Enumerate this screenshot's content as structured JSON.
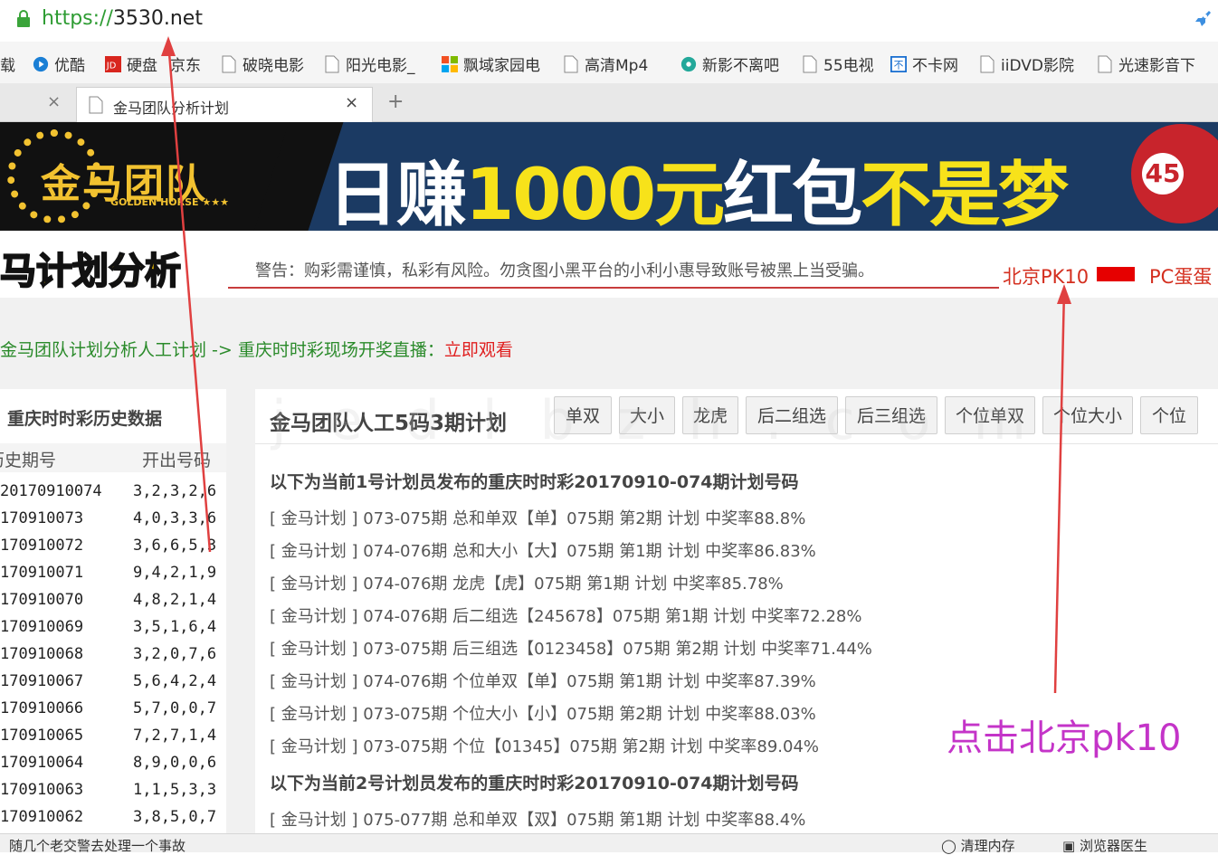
{
  "browser": {
    "url_protocol": "https://",
    "url_host": "3530.net",
    "bookmarks": [
      "载",
      "优酷",
      "硬盘",
      "京东",
      "破晓电影",
      "阳光电影_",
      "飘域家园电",
      "高清Mp4",
      "新影不离吧",
      "55电视",
      "不卡网",
      "iiDVD影院",
      "光速影音下"
    ],
    "active_tab_title": "金马团队分析计划",
    "close_glyph": "×",
    "new_tab_glyph": "+"
  },
  "banner": {
    "logo_text": "金马团队",
    "logo_sub": "GOLDEN HORSE ★★★",
    "slogan_a": "日赚",
    "slogan_b": "1000元",
    "slogan_c": "红包",
    "slogan_d": "不是梦",
    "ball_number": "45"
  },
  "header": {
    "brand": "马计划分析",
    "warning": "警告：购彩需谨慎，私彩有风险。勿贪图小黑平台的小利小惠导致账号被黑上当受骗。",
    "link_pk10": "北京PK10",
    "link_pc": "PC蛋蛋"
  },
  "breadcrumb": {
    "part1": "金马团队计划分析人工计划 -> 重庆时时彩现场开奖直播：",
    "part2": "立即观看"
  },
  "sidebar": {
    "title": "重庆时时彩历史数据",
    "col_period": "历史期号",
    "col_numbers": "开出号码",
    "rows": [
      {
        "period": "20170910074",
        "numbers": "3,2,3,2,6"
      },
      {
        "period": "170910073",
        "numbers": "4,0,3,3,6"
      },
      {
        "period": "170910072",
        "numbers": "3,6,6,5,3"
      },
      {
        "period": "170910071",
        "numbers": "9,4,2,1,9"
      },
      {
        "period": "170910070",
        "numbers": "4,8,2,1,4"
      },
      {
        "period": "170910069",
        "numbers": "3,5,1,6,4"
      },
      {
        "period": "170910068",
        "numbers": "3,2,0,7,6"
      },
      {
        "period": "170910067",
        "numbers": "5,6,4,2,4"
      },
      {
        "period": "170910066",
        "numbers": "5,7,0,0,7"
      },
      {
        "period": "170910065",
        "numbers": "7,2,7,1,4"
      },
      {
        "period": "170910064",
        "numbers": "8,9,0,0,6"
      },
      {
        "period": "170910063",
        "numbers": "1,1,5,3,3"
      },
      {
        "period": "170910062",
        "numbers": "3,8,5,0,7"
      }
    ]
  },
  "main": {
    "title": "金马团队人工5码3期计划",
    "buttons": [
      "单双",
      "大小",
      "龙虎",
      "后二组选",
      "后三组选",
      "个位单双",
      "个位大小",
      "个位"
    ],
    "section1": "以下为当前1号计划员发布的重庆时时彩20170910-074期计划号码",
    "plans": [
      "[ 金马计划 ] 073-075期 总和单双【单】075期 第2期 计划 中奖率88.8%",
      "[ 金马计划 ] 074-076期 总和大小【大】075期 第1期 计划 中奖率86.83%",
      "[ 金马计划 ] 074-076期 龙虎【虎】075期 第1期 计划 中奖率85.78%",
      "[ 金马计划 ] 074-076期 后二组选【245678】075期 第1期 计划 中奖率72.28%",
      "[ 金马计划 ] 073-075期 后三组选【0123458】075期 第2期 计划 中奖率71.44%",
      "[ 金马计划 ] 074-076期 个位单双【单】075期 第1期 计划 中奖率87.39%",
      "[ 金马计划 ] 073-075期 个位大小【小】075期 第2期 计划 中奖率88.03%",
      "[ 金马计划 ] 073-075期 个位【01345】075期 第2期 计划 中奖率89.04%"
    ],
    "section2": "以下为当前2号计划员发布的重庆时时彩20170910-074期计划号码",
    "plans2": [
      "[ 金马计划 ] 075-077期 总和单双【双】075期 第1期 计划 中奖率88.4%"
    ]
  },
  "annotation": "点击北京pk10",
  "status": {
    "left": "随几个老交警去处理一个事故",
    "mem": "清理内存",
    "doctor": "浏览器医生"
  }
}
